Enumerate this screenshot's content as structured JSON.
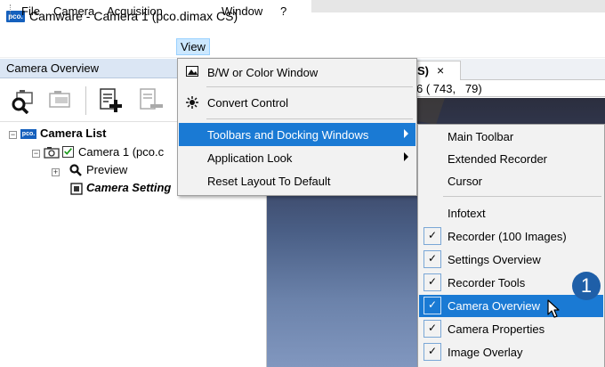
{
  "window": {
    "title": "Camware - Camera 1 (pco.dimax CS)",
    "logo_text": "pco."
  },
  "menubar": {
    "items": [
      "File",
      "Camera",
      "Acquisition",
      "View",
      "Window",
      "?"
    ]
  },
  "camera_overview": {
    "title": "Camera Overview",
    "tree": {
      "root": "Camera List",
      "root_logo": "pco.",
      "camera": "Camera 1 (pco.c",
      "preview": "Preview",
      "settings": "Camera Setting"
    }
  },
  "document": {
    "tab_label": "S)",
    "tab_close": "×",
    "info_text": "6 ( 743,   79)"
  },
  "view_menu": {
    "items": [
      {
        "label": "B/W or Color Window",
        "icon": "bw-window-icon"
      },
      {
        "label": "Convert Control",
        "icon": "convert-control-icon"
      },
      {
        "label": "Toolbars and Docking Windows",
        "submenu": true
      },
      {
        "label": "Application Look",
        "submenu": true
      },
      {
        "label": "Reset Layout To Default"
      }
    ]
  },
  "toolbars_submenu": {
    "items": [
      {
        "label": "Main Toolbar",
        "checked": false
      },
      {
        "label": "Extended Recorder",
        "checked": false
      },
      {
        "label": "Cursor",
        "checked": false
      },
      {
        "label": "Infotext",
        "checked": false
      },
      {
        "label": "Recorder (100 Images)",
        "checked": true
      },
      {
        "label": "Settings Overview",
        "checked": true
      },
      {
        "label": "Recorder Tools",
        "checked": true
      },
      {
        "label": "Camera Overview",
        "checked": true,
        "highlighted": true
      },
      {
        "label": "Camera Properties",
        "checked": true
      },
      {
        "label": "Image Overlay",
        "checked": true
      }
    ],
    "check_mark": "✓"
  },
  "callout": {
    "number": "1"
  },
  "colors": {
    "highlight": "#1a7ad4",
    "callout": "#1f5fa8",
    "panel_header": "#dbe6f4"
  }
}
